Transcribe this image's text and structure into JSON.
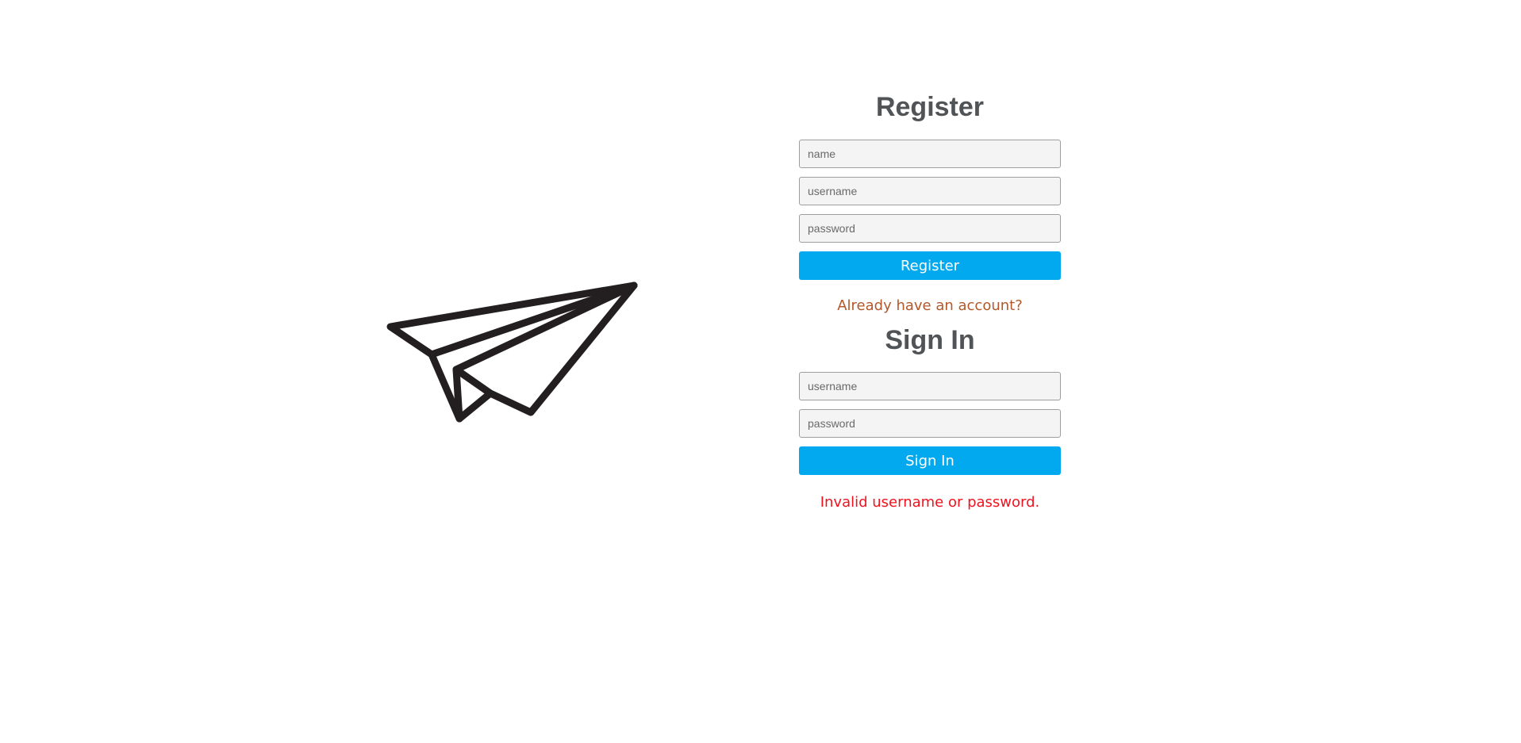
{
  "logo": {
    "icon": "paper-plane-icon",
    "color": "#231f20"
  },
  "register": {
    "title": "Register",
    "name_placeholder": "name",
    "username_placeholder": "username",
    "password_placeholder": "password",
    "button_label": "Register",
    "signin_link": "Already have an account?"
  },
  "signin": {
    "title": "Sign In",
    "username_placeholder": "username",
    "password_placeholder": "password",
    "button_label": "Sign In",
    "error_message": "Invalid username or password."
  },
  "colors": {
    "accent": "#03a9ee",
    "heading": "#505456",
    "link": "#b3582a",
    "error": "#f0131e",
    "field_bg": "#f4f4f4"
  }
}
